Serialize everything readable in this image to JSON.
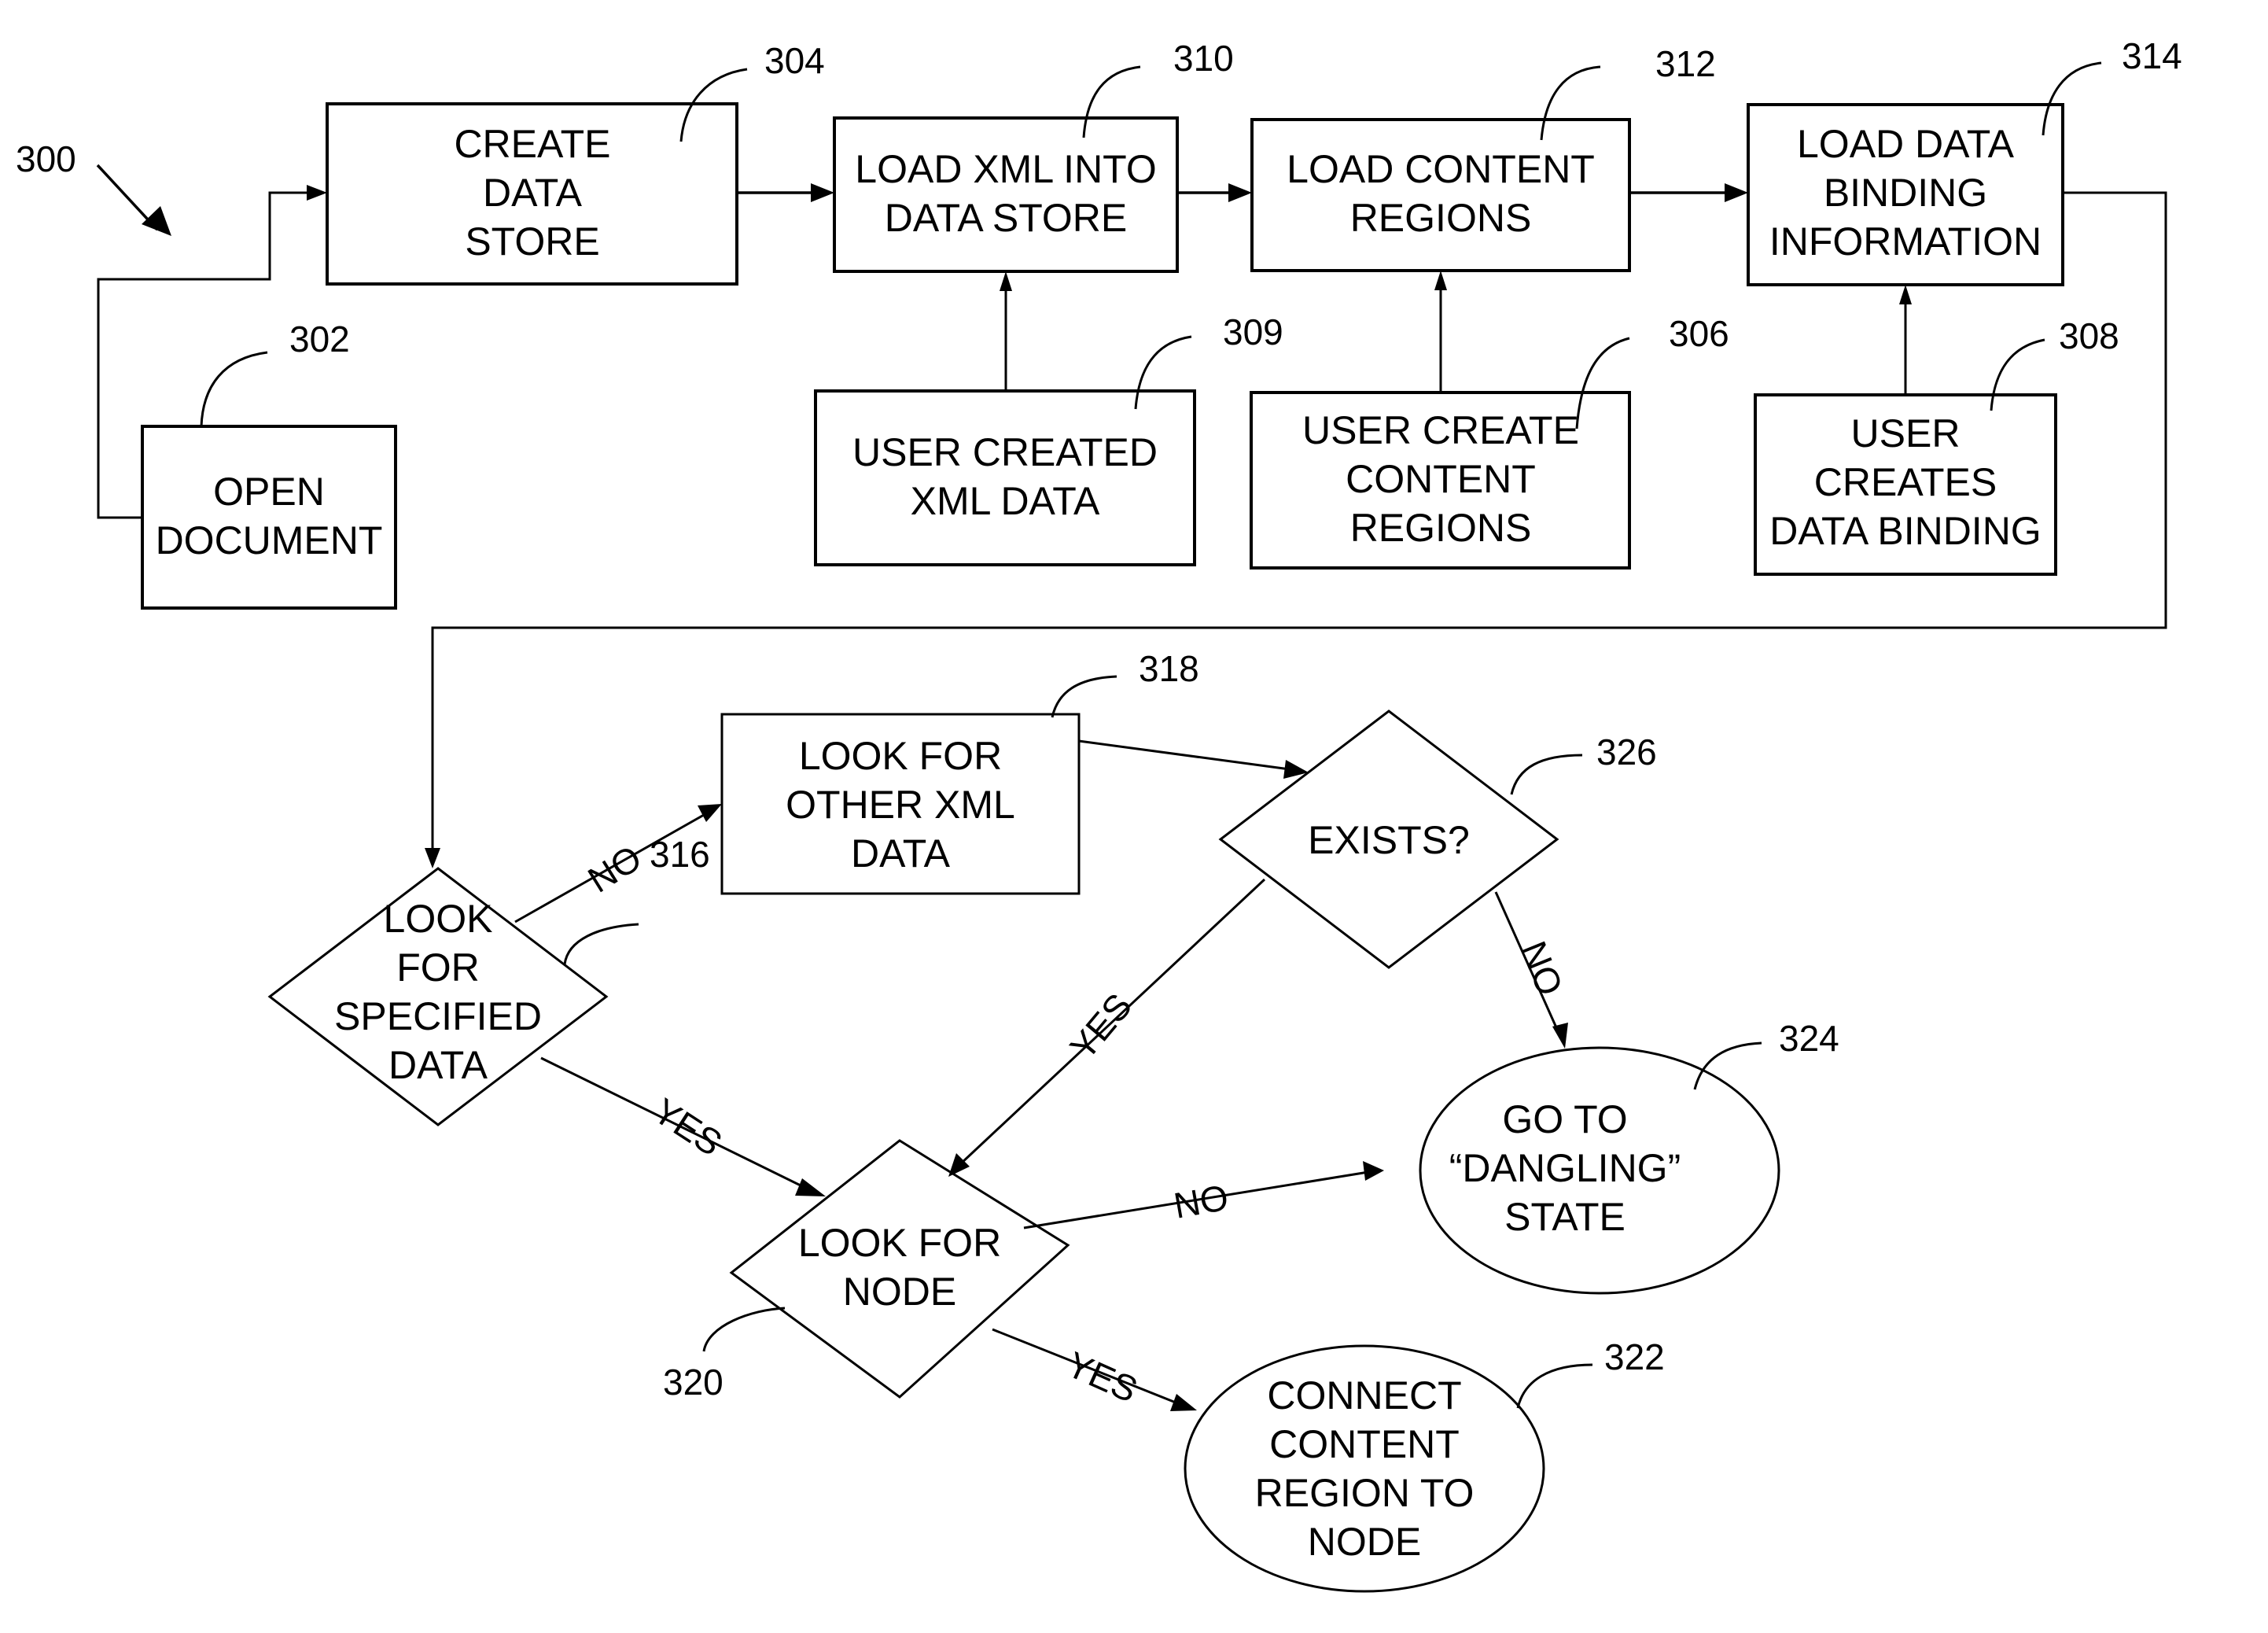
{
  "figure": {
    "number": "300"
  },
  "nodes": {
    "open_document": {
      "ref": "302",
      "lines": [
        "OPEN",
        "DOCUMENT"
      ]
    },
    "create_data_store": {
      "ref": "304",
      "lines": [
        "CREATE",
        "DATA",
        "STORE"
      ]
    },
    "load_xml": {
      "ref": "310",
      "lines": [
        "LOAD XML INTO",
        "DATA STORE"
      ]
    },
    "load_content_regions": {
      "ref": "312",
      "lines": [
        "LOAD CONTENT",
        "REGIONS"
      ]
    },
    "load_data_binding": {
      "ref": "314",
      "lines": [
        "LOAD DATA",
        "BINDING",
        "INFORMATION"
      ]
    },
    "user_created_xml": {
      "ref": "309",
      "lines": [
        "USER CREATED",
        "XML DATA"
      ]
    },
    "user_create_regions": {
      "ref": "306",
      "lines": [
        "USER CREATE",
        "CONTENT",
        "REGIONS"
      ]
    },
    "user_creates_binding": {
      "ref": "308",
      "lines": [
        "USER",
        "CREATES",
        "DATA BINDING"
      ]
    },
    "look_specified": {
      "ref": "316",
      "lines": [
        "LOOK",
        "FOR",
        "SPECIFIED",
        "DATA"
      ]
    },
    "look_other_xml": {
      "ref": "318",
      "lines": [
        "LOOK FOR",
        "OTHER XML",
        "DATA"
      ]
    },
    "exists": {
      "ref": "326",
      "lines": [
        "EXISTS?"
      ]
    },
    "look_node": {
      "ref": "320",
      "lines": [
        "LOOK FOR",
        "NODE"
      ]
    },
    "dangling": {
      "ref": "324",
      "lines": [
        "GO TO",
        "“DANGLING”",
        "STATE"
      ]
    },
    "connect": {
      "ref": "322",
      "lines": [
        "CONNECT",
        "CONTENT",
        "REGION TO",
        "NODE"
      ]
    }
  },
  "edge_labels": {
    "specified_no": "NO",
    "specified_yes": "YES",
    "exists_yes": "YES",
    "exists_no": "NO",
    "node_no": "NO",
    "node_yes": "YES"
  }
}
